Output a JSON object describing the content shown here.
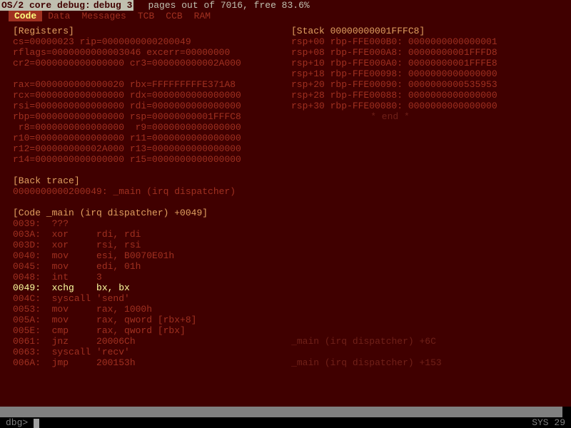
{
  "title_left": "OS/2 core debug:",
  "title_right": " debug 3",
  "status_line": "pages out of 7016, free 83.6%",
  "tabs": [
    "Code",
    "Data",
    "Messages",
    "TCB",
    "CCB",
    "RAM"
  ],
  "active_tab": 0,
  "registers": {
    "header": "[Registers]",
    "lines": [
      "cs=00000023 rip=0000000000200049",
      "rflags=0000000000003046 excerr=00000000",
      "cr2=0000000000000000 cr3=000000000002A000",
      "",
      "rax=0000000000000020 rbx=FFFFFFFFFE371A8",
      "rcx=0000000000000000 rdx=0000000000000000",
      "rsi=0000000000000000 rdi=0000000000000000",
      "rbp=0000000000000000 rsp=00000000001FFFC8",
      " r8=0000000000000000  r9=0000000000000000",
      "r10=0000000000000000 r11=0000000000000000",
      "r12=000000000002A000 r13=0000000000000000",
      "r14=0000000000000000 r15=0000000000000000"
    ]
  },
  "stack": {
    "header": "[Stack 00000000001FFFC8]",
    "lines": [
      "rsp+00 rbp-FFE000B0: 0000000000000001",
      "rsp+08 rbp-FFE000A8: 00000000001FFFD8",
      "rsp+10 rbp-FFE000A0: 00000000001FFFE8",
      "rsp+18 rbp-FFE00098: 0000000000000000",
      "rsp+20 rbp-FFE00090: 0000000000535953",
      "rsp+28 rbp-FFE00088: 0000000000000000",
      "rsp+30 rbp-FFE00080: 0000000000000000"
    ],
    "end": "    * end *"
  },
  "backtrace": {
    "header": "[Back trace]",
    "line": "0000000000200049: _main (irq dispatcher)"
  },
  "code": {
    "header": "[Code _main (irq dispatcher) +0049]",
    "lines": [
      {
        "addr": "0039:",
        "op": "???",
        "args": "",
        "note": ""
      },
      {
        "addr": "003A:",
        "op": "xor",
        "args": "rdi, rdi",
        "note": ""
      },
      {
        "addr": "003D:",
        "op": "xor",
        "args": "rsi, rsi",
        "note": ""
      },
      {
        "addr": "0040:",
        "op": "mov",
        "args": "esi, B0070E01h",
        "note": ""
      },
      {
        "addr": "0045:",
        "op": "mov",
        "args": "edi, 01h",
        "note": ""
      },
      {
        "addr": "0048:",
        "op": "int",
        "args": "3",
        "note": ""
      },
      {
        "addr": "0049:",
        "op": "xchg",
        "args": "bx, bx",
        "note": "",
        "highlight": true
      },
      {
        "addr": "004C:",
        "op": "syscall",
        "args": "'send'",
        "note": ""
      },
      {
        "addr": "0053:",
        "op": "mov",
        "args": "rax, 1000h",
        "note": ""
      },
      {
        "addr": "005A:",
        "op": "mov",
        "args": "rax, qword [rbx+8]",
        "note": ""
      },
      {
        "addr": "005E:",
        "op": "cmp",
        "args": "rax, qword [rbx]",
        "note": ""
      },
      {
        "addr": "0061:",
        "op": "jnz",
        "args": "20006Ch",
        "note": "_main (irq dispatcher) +6C"
      },
      {
        "addr": "0063:",
        "op": "syscall",
        "args": "'recv'",
        "note": ""
      },
      {
        "addr": "006A:",
        "op": "jmp",
        "args": "200153h",
        "note": "_main (irq dispatcher) +153"
      }
    ]
  },
  "prompt": "dbg>",
  "sys_label": "SYS 29"
}
